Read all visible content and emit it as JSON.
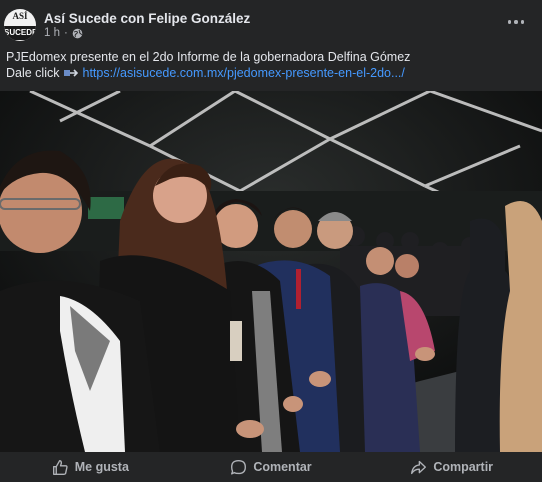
{
  "post": {
    "page_name": "Así Sucede con Felipe González",
    "time": "1 h",
    "separator": "·",
    "avatar_top": "ASÍ",
    "avatar_bottom": "SUCEDE",
    "text_line1": "PJEdomex presente en el 2do Informe de la gobernadora Delfina Gómez",
    "text_line2_prefix": "Dale click",
    "link": "https://asisucede.com.mx/pjedomex-presente-en-el-2do.../"
  },
  "actions": {
    "like": "Me gusta",
    "comment": "Comentar",
    "share": "Compartir"
  },
  "colors": {
    "background": "#242526",
    "text": "#e4e6eb",
    "secondary_text": "#b0b3b8",
    "link": "#4599ff"
  },
  "icons": [
    "globe-icon",
    "more-options-icon",
    "link-icon",
    "like-icon",
    "comment-icon",
    "share-icon"
  ]
}
